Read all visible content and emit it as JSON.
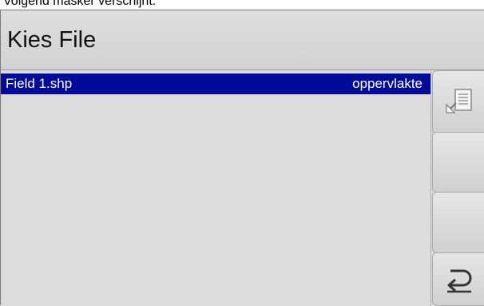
{
  "caption": "Volgend masker verschijnt:",
  "title": "Kies File",
  "file_list": {
    "rows": [
      {
        "name": "Field 1.shp",
        "type": "oppervlakte",
        "selected": true
      }
    ]
  },
  "softkeys": [
    {
      "icon": "import-document-icon"
    },
    {
      "icon": ""
    },
    {
      "icon": ""
    },
    {
      "icon": "return-arrow-icon"
    }
  ],
  "colors": {
    "selection": "#000c99",
    "background": "#dcdcdc"
  }
}
